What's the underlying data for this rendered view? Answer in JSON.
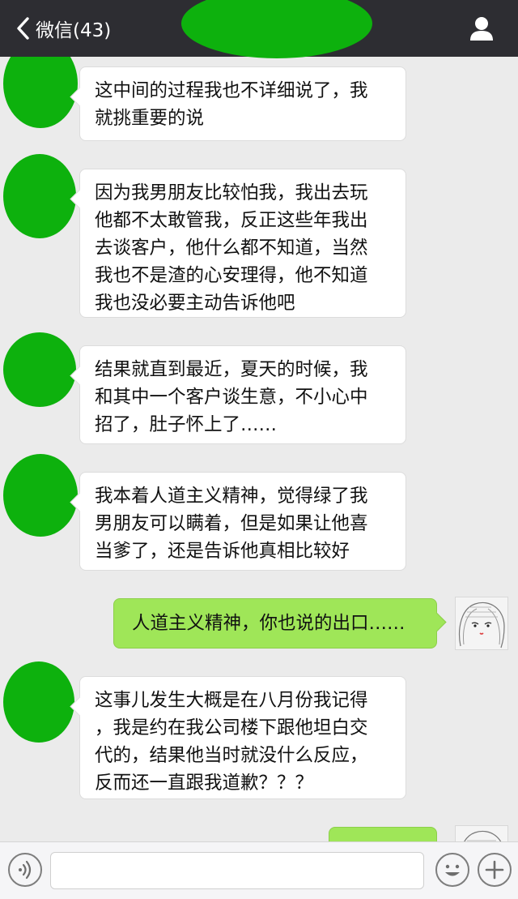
{
  "header": {
    "back_label": "微信(43)",
    "back_icon": "chevron-left-icon",
    "profile_icon": "person-icon"
  },
  "messages": [
    {
      "side": "in",
      "text_lines": [
        "这中间的过程我也不详细说了，我",
        "就挑重要的说"
      ]
    },
    {
      "side": "in",
      "text_lines": [
        "因为我男朋友比较怕我，我出去玩",
        "他都不太敢管我，反正这些年我出",
        "去谈客户，他什么都不知道，当然",
        "我也不是渣的心安理得，他不知道",
        "我也没必要主动告诉他吧"
      ]
    },
    {
      "side": "in",
      "text_lines": [
        "结果就直到最近，夏天的时候，我",
        "和其中一个客户谈生意，不小心中",
        "招了，肚子怀上了……"
      ]
    },
    {
      "side": "in",
      "text_lines": [
        "我本着人道主义精神，觉得绿了我",
        "男朋友可以瞒着，但是如果让他喜",
        "当爹了，还是告诉他真相比较好"
      ]
    },
    {
      "side": "out",
      "text_lines": [
        "人道主义精神，你也说的出口……"
      ]
    },
    {
      "side": "in",
      "text_lines": [
        "这事儿发生大概是在八月份我记得",
        "，我是约在我公司楼下跟他坦白交",
        "代的，结果他当时就没什么反应，",
        "反而还一直跟我道歉？？？"
      ]
    },
    {
      "side": "out",
      "text_lines": [
        ""
      ]
    }
  ],
  "input_bar": {
    "voice_icon": "voice-icon",
    "emoji_icon": "emoji-icon",
    "plus_icon": "plus-icon",
    "placeholder": ""
  },
  "colors": {
    "topbar": "#2d2d32",
    "background": "#ebebeb",
    "redaction_green": "#0db10d",
    "outgoing_bubble": "#9fe658",
    "incoming_bubble": "#ffffff"
  }
}
